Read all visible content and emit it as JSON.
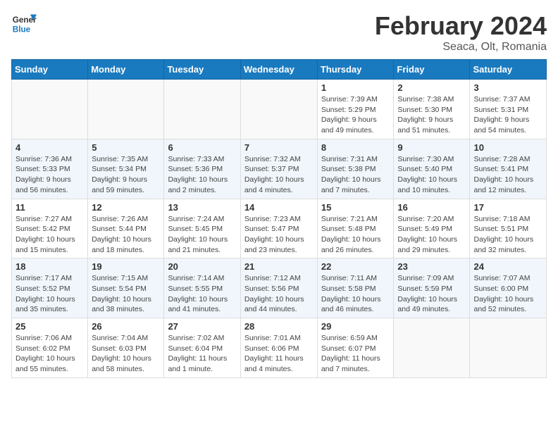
{
  "header": {
    "logo_line1": "General",
    "logo_line2": "Blue",
    "month": "February 2024",
    "location": "Seaca, Olt, Romania"
  },
  "weekdays": [
    "Sunday",
    "Monday",
    "Tuesday",
    "Wednesday",
    "Thursday",
    "Friday",
    "Saturday"
  ],
  "weeks": [
    [
      {
        "day": "",
        "info": ""
      },
      {
        "day": "",
        "info": ""
      },
      {
        "day": "",
        "info": ""
      },
      {
        "day": "",
        "info": ""
      },
      {
        "day": "1",
        "info": "Sunrise: 7:39 AM\nSunset: 5:29 PM\nDaylight: 9 hours\nand 49 minutes."
      },
      {
        "day": "2",
        "info": "Sunrise: 7:38 AM\nSunset: 5:30 PM\nDaylight: 9 hours\nand 51 minutes."
      },
      {
        "day": "3",
        "info": "Sunrise: 7:37 AM\nSunset: 5:31 PM\nDaylight: 9 hours\nand 54 minutes."
      }
    ],
    [
      {
        "day": "4",
        "info": "Sunrise: 7:36 AM\nSunset: 5:33 PM\nDaylight: 9 hours\nand 56 minutes."
      },
      {
        "day": "5",
        "info": "Sunrise: 7:35 AM\nSunset: 5:34 PM\nDaylight: 9 hours\nand 59 minutes."
      },
      {
        "day": "6",
        "info": "Sunrise: 7:33 AM\nSunset: 5:36 PM\nDaylight: 10 hours\nand 2 minutes."
      },
      {
        "day": "7",
        "info": "Sunrise: 7:32 AM\nSunset: 5:37 PM\nDaylight: 10 hours\nand 4 minutes."
      },
      {
        "day": "8",
        "info": "Sunrise: 7:31 AM\nSunset: 5:38 PM\nDaylight: 10 hours\nand 7 minutes."
      },
      {
        "day": "9",
        "info": "Sunrise: 7:30 AM\nSunset: 5:40 PM\nDaylight: 10 hours\nand 10 minutes."
      },
      {
        "day": "10",
        "info": "Sunrise: 7:28 AM\nSunset: 5:41 PM\nDaylight: 10 hours\nand 12 minutes."
      }
    ],
    [
      {
        "day": "11",
        "info": "Sunrise: 7:27 AM\nSunset: 5:42 PM\nDaylight: 10 hours\nand 15 minutes."
      },
      {
        "day": "12",
        "info": "Sunrise: 7:26 AM\nSunset: 5:44 PM\nDaylight: 10 hours\nand 18 minutes."
      },
      {
        "day": "13",
        "info": "Sunrise: 7:24 AM\nSunset: 5:45 PM\nDaylight: 10 hours\nand 21 minutes."
      },
      {
        "day": "14",
        "info": "Sunrise: 7:23 AM\nSunset: 5:47 PM\nDaylight: 10 hours\nand 23 minutes."
      },
      {
        "day": "15",
        "info": "Sunrise: 7:21 AM\nSunset: 5:48 PM\nDaylight: 10 hours\nand 26 minutes."
      },
      {
        "day": "16",
        "info": "Sunrise: 7:20 AM\nSunset: 5:49 PM\nDaylight: 10 hours\nand 29 minutes."
      },
      {
        "day": "17",
        "info": "Sunrise: 7:18 AM\nSunset: 5:51 PM\nDaylight: 10 hours\nand 32 minutes."
      }
    ],
    [
      {
        "day": "18",
        "info": "Sunrise: 7:17 AM\nSunset: 5:52 PM\nDaylight: 10 hours\nand 35 minutes."
      },
      {
        "day": "19",
        "info": "Sunrise: 7:15 AM\nSunset: 5:54 PM\nDaylight: 10 hours\nand 38 minutes."
      },
      {
        "day": "20",
        "info": "Sunrise: 7:14 AM\nSunset: 5:55 PM\nDaylight: 10 hours\nand 41 minutes."
      },
      {
        "day": "21",
        "info": "Sunrise: 7:12 AM\nSunset: 5:56 PM\nDaylight: 10 hours\nand 44 minutes."
      },
      {
        "day": "22",
        "info": "Sunrise: 7:11 AM\nSunset: 5:58 PM\nDaylight: 10 hours\nand 46 minutes."
      },
      {
        "day": "23",
        "info": "Sunrise: 7:09 AM\nSunset: 5:59 PM\nDaylight: 10 hours\nand 49 minutes."
      },
      {
        "day": "24",
        "info": "Sunrise: 7:07 AM\nSunset: 6:00 PM\nDaylight: 10 hours\nand 52 minutes."
      }
    ],
    [
      {
        "day": "25",
        "info": "Sunrise: 7:06 AM\nSunset: 6:02 PM\nDaylight: 10 hours\nand 55 minutes."
      },
      {
        "day": "26",
        "info": "Sunrise: 7:04 AM\nSunset: 6:03 PM\nDaylight: 10 hours\nand 58 minutes."
      },
      {
        "day": "27",
        "info": "Sunrise: 7:02 AM\nSunset: 6:04 PM\nDaylight: 11 hours\nand 1 minute."
      },
      {
        "day": "28",
        "info": "Sunrise: 7:01 AM\nSunset: 6:06 PM\nDaylight: 11 hours\nand 4 minutes."
      },
      {
        "day": "29",
        "info": "Sunrise: 6:59 AM\nSunset: 6:07 PM\nDaylight: 11 hours\nand 7 minutes."
      },
      {
        "day": "",
        "info": ""
      },
      {
        "day": "",
        "info": ""
      }
    ]
  ]
}
